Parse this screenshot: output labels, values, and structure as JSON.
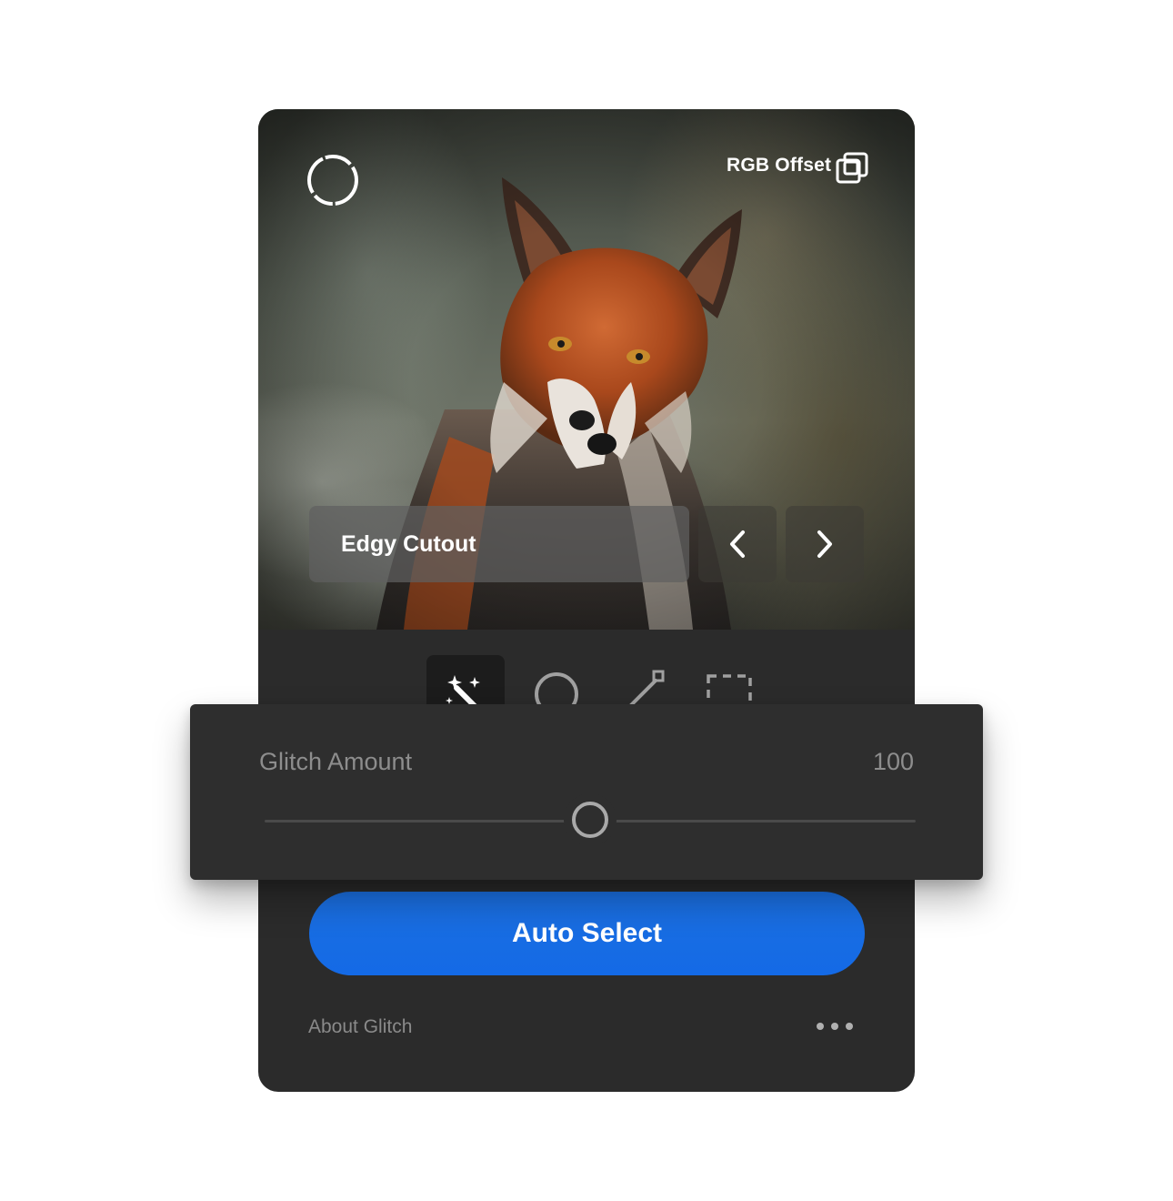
{
  "photo": {
    "effect_label": "RGB Offset"
  },
  "preset": {
    "name": "Edgy Cutout"
  },
  "tools": [
    {
      "icon": "magic-wand-icon",
      "active": true
    },
    {
      "icon": "circle-select-icon",
      "active": false
    },
    {
      "icon": "line-tool-icon",
      "active": false
    },
    {
      "icon": "rect-select-icon",
      "active": false
    }
  ],
  "slider": {
    "label": "Glitch Amount",
    "value": "100",
    "position_fraction": 0.5
  },
  "actions": {
    "primary_label": "Auto Select",
    "about_label": "About Glitch"
  },
  "colors": {
    "panel_bg": "#2b2b2b",
    "slider_panel_bg": "#2e2e2e",
    "accent_blue": "#146ae6",
    "muted_text": "#8d8d8d"
  }
}
